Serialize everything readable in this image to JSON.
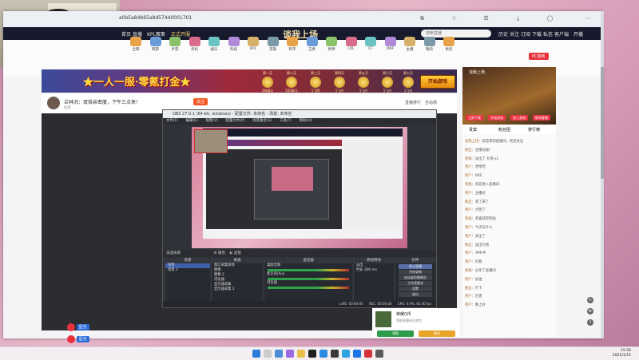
{
  "browser": {
    "url": "a0b5a84b65a8d57440001701",
    "toolbar_icons": [
      "back-icon",
      "forward-icon",
      "refresh-icon",
      "home-icon",
      "star-icon",
      "reading-icon",
      "extensions-icon",
      "download-icon",
      "menu-icon"
    ]
  },
  "site_nav": {
    "items": [
      "首页",
      "直播",
      "KPL赛事"
    ],
    "center_notice": "正式开服",
    "logo": "谈我上场",
    "search_placeholder": "搜索直播",
    "right_items": [
      "历史",
      "关注",
      "订阅",
      "下载",
      "私信",
      "客户端",
      "开播"
    ],
    "accent": "#171a2c"
  },
  "toolbar": {
    "items": [
      "全网",
      "网游",
      "手游",
      "单机",
      "娱乐",
      "科技",
      "KPL",
      "英雄",
      "和平",
      "王者",
      "原神",
      "LOL",
      "CF",
      "DNF",
      "主播",
      "我的",
      "更多"
    ],
    "pc_tag": "PC游戏"
  },
  "banner": {
    "headline": "★一人一服·零氪打金★",
    "days": [
      "第一天",
      "第二天",
      "第三天",
      "第四天",
      "第五天",
      "第六天",
      "第七天"
    ],
    "day_rewards": [
      "2W绑元",
      "500绑元",
      "1飞鸽",
      "1飞刃",
      "1飞刃",
      "1飞刃",
      "1飞刃"
    ],
    "button": "开始游戏"
  },
  "streamer": {
    "name": "兰林况：双倍亲密度，下午三点来！",
    "follow_label": "关注",
    "tags": [
      "标签",
      "关注",
      "粉丝",
      "分享",
      "举报"
    ],
    "rank_label": "直播排行",
    "gift_label": "全站榜"
  },
  "obs": {
    "title": "OBS 27.0.1 (64-bit, windows) - 配置文件: 未命名 - 场景: 未命名",
    "menu": [
      "文件(F)",
      "编辑(E)",
      "视图(V)",
      "配置文件(P)",
      "场景集合(S)",
      "工具(T)",
      "帮助(H)"
    ],
    "subbar_text": "未选择源",
    "properties": "属性",
    "filters": "滤镜",
    "docks": {
      "scenes": {
        "title": "场景",
        "rows": [
          "场景",
          "场景 2"
        ]
      },
      "sources": {
        "title": "来源",
        "rows": [
          "窗口采集游戏",
          "图像",
          "图像 2",
          "浏览器",
          "显示器采集",
          "显示器采集 2"
        ]
      },
      "mixer": {
        "title": "混音器",
        "rows": [
          "桌面音频",
          "麦克风/Aux",
          "浏览器"
        ]
      },
      "transitions": {
        "title": "转场特效",
        "rows": [
          "淡出",
          "时长 300 ms"
        ]
      },
      "controls": {
        "title": "控件",
        "buttons": [
          "停止直播",
          "开始录制",
          "启动虚拟摄像机",
          "工作室模式",
          "设置",
          "退出"
        ]
      }
    },
    "status": {
      "live": "LIVE: 00:00:00",
      "rec": "REC: 00:00:00",
      "cpu": "CPU: 0.9%, 60.00 fps"
    }
  },
  "promo": {
    "title": "谈我上场",
    "buttons": [
      "立即下载",
      "开始游戏",
      "进入游戏",
      "联系客服"
    ]
  },
  "side_tabs": [
    "贵宾",
    "粉丝团",
    "排行榜"
  ],
  "chat": [
    {
      "user": "谈我上场",
      "text": "：欢迎来到直播间，欢迎关注"
    },
    {
      "user": "粉丝",
      "text": "：主播加油！"
    },
    {
      "user": "系统",
      "text": "：送出了 礼物 x1"
    },
    {
      "user": "用户",
      "text": "：哈哈哈"
    },
    {
      "user": "用户",
      "text": "：666"
    },
    {
      "user": "系统",
      "text": "：欢迎进入直播间"
    },
    {
      "user": "用户",
      "text": "：主播好"
    },
    {
      "user": "粉丝",
      "text": "：来了来了"
    },
    {
      "user": "用户",
      "text": "：点赞了"
    },
    {
      "user": "系统",
      "text": "：恭喜获得奖励"
    },
    {
      "user": "用户",
      "text": "：今天玩什么"
    },
    {
      "user": "用户",
      "text": "：关注了"
    },
    {
      "user": "粉丝",
      "text": "：送出礼物"
    },
    {
      "user": "用户",
      "text": "：冲冲冲"
    },
    {
      "user": "用户",
      "text": "：好看"
    },
    {
      "user": "系统",
      "text": "：分享了直播间"
    },
    {
      "user": "用户",
      "text": "：加油"
    },
    {
      "user": "粉丝",
      "text": "：打卡"
    },
    {
      "user": "用户",
      "text": "：厉害"
    },
    {
      "user": "用户",
      "text": "：晚上好"
    }
  ],
  "gift": {
    "name": "荣耀Q币",
    "desc": "领取直播间礼物包",
    "buttons": [
      "领取",
      "赠送"
    ]
  },
  "badges": [
    "星光",
    "星光"
  ],
  "clock": {
    "time": "15:56",
    "date": "2025/1/15"
  }
}
